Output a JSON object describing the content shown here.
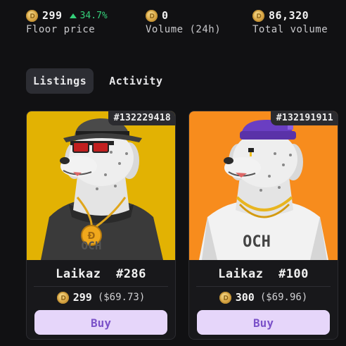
{
  "stats": {
    "floor": {
      "value": "299",
      "change": "34.7%",
      "label": "Floor price",
      "icon": "coin-icon"
    },
    "volume24h": {
      "value": "0",
      "label": "Volume (24h)",
      "icon": "coin-icon"
    },
    "total": {
      "value": "86,320",
      "label": "Total volume",
      "icon": "coin-icon"
    }
  },
  "tabs": [
    {
      "label": "Listings",
      "active": true
    },
    {
      "label": "Activity",
      "active": false
    }
  ],
  "listings": [
    {
      "id": "#132229418",
      "name": "Laikaz  #286",
      "price": "299",
      "usd": "($69.73)",
      "buy_label": "Buy",
      "bg_color": "#e2b203",
      "shirt_text": "OCH"
    },
    {
      "id": "#132191911",
      "name": "Laikaz  #100",
      "price": "300",
      "usd": "($69.96)",
      "buy_label": "Buy",
      "bg_color": "#f78c1d",
      "shirt_text": "OCH"
    }
  ],
  "colors": {
    "accent_green": "#35d07a",
    "buy_bg": "#e6d6fa",
    "buy_text": "#7b52c9"
  }
}
